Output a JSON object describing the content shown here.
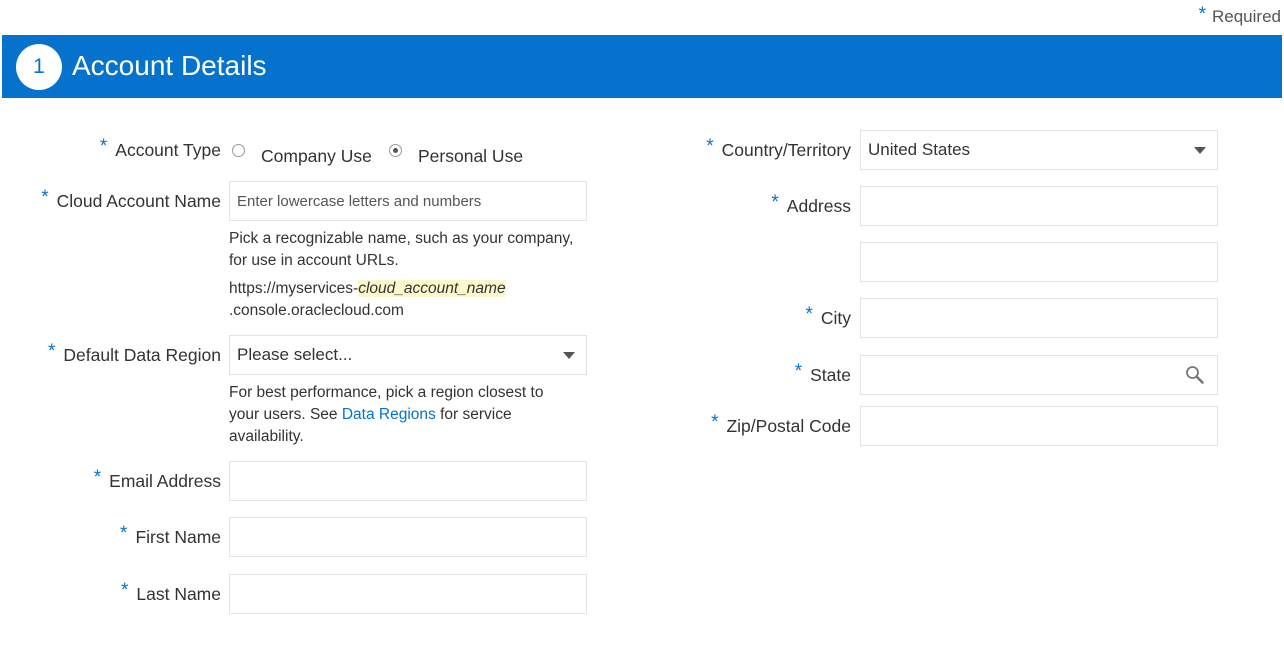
{
  "required_note": {
    "star": "*",
    "text": "Required"
  },
  "banner": {
    "step": "1",
    "title": "Account Details"
  },
  "left": {
    "account_type": {
      "label": "Account Type",
      "options": [
        "Company Use",
        "Personal Use"
      ],
      "selected": "Personal Use"
    },
    "cloud_account_name": {
      "label": "Cloud Account Name",
      "placeholder": "Enter lowercase letters and numbers",
      "help_line1": "Pick a recognizable name, such as your company,",
      "help_line2": "for use in account URLs.",
      "url_prefix": "https://myservices-",
      "url_highlight": "cloud_account_name",
      "url_suffix": ".console.oraclecloud.com"
    },
    "default_data_region": {
      "label": "Default Data Region",
      "value": "Please select...",
      "help_line1": "For best performance, pick a region closest to",
      "help_line2_before": "your users. See ",
      "help_link": "Data Regions",
      "help_line2_after": " for service",
      "help_line3": "availability."
    },
    "email": {
      "label": "Email Address",
      "value": ""
    },
    "first_name": {
      "label": "First Name",
      "value": ""
    },
    "last_name": {
      "label": "Last Name",
      "value": ""
    }
  },
  "right": {
    "country": {
      "label": "Country/Territory",
      "value": "United States"
    },
    "address": {
      "label": "Address",
      "line1": "",
      "line2": ""
    },
    "city": {
      "label": "City",
      "value": ""
    },
    "state": {
      "label": "State",
      "value": ""
    },
    "zip": {
      "label": "Zip/Postal Code",
      "value": ""
    }
  },
  "icons": {
    "dropdown": "chevron-down-icon",
    "search": "search-icon"
  },
  "colors": {
    "accent": "#0572ce",
    "highlight": "#fbf9cc",
    "border": "#dfe4e7"
  }
}
